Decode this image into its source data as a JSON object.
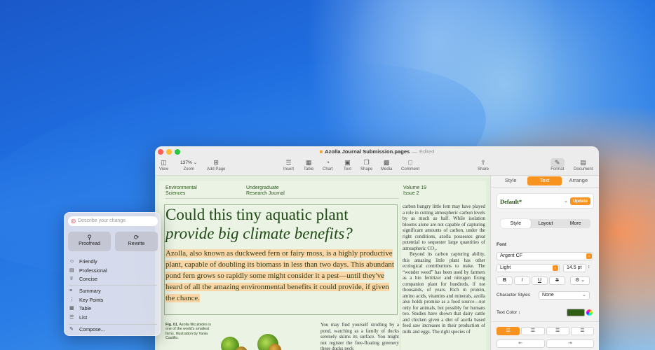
{
  "window": {
    "title": "Azolla Journal Submission.pages",
    "status": "Edited",
    "traffic_lights": {
      "close": "#ff5f57",
      "minimize": "#febc2e",
      "zoom": "#28c840"
    }
  },
  "toolbar": {
    "view": "View",
    "zoom_value": "137%",
    "zoom": "Zoom",
    "add_page": "Add Page",
    "insert": "Insert",
    "table": "Table",
    "chart": "Chart",
    "text": "Text",
    "shape": "Shape",
    "media": "Media",
    "comment": "Comment",
    "share": "Share",
    "format": "Format",
    "document": "Document"
  },
  "page": {
    "header_left": "Environmental Sciences",
    "header_mid": "Undergraduate Research Journal",
    "header_right": "Volume 19 Issue 2",
    "headline_line1": "Could this tiny aquatic plant",
    "headline_line2": "provide big climate benefits?",
    "lead": "Azolla, also known as duckweed fern or fairy moss, is a highly productive plant, capable of doubling its biomass in less than two days. This abundant pond fern grows so rapidly some might consider it a pest—until they've heard of all the amazing environmental benefits it could provide, if given the chance.",
    "fig_label": "Fig. 01.",
    "fig_caption": "Azolla filiculoides is one of the world's smallest ferns. Illustration by Tania Castillo.",
    "body_mid": "You may find yourself strolling by a pond, watching as a family of ducks serenely skims its surface. You might not register the free-floating greenery these ducks peck",
    "body_right_p1": "carbon hungry little fern may have played a role in cutting atmospheric carbon levels by as much as half. While isolation blooms alone are not capable of capturing significant amounts of carbon, under the right conditions, azolla possesses great potential to sequester large quantities of atmospheric CO₂.",
    "body_right_p2": "Beyond its carbon capturing ability, this amazing little plant has other ecological contributions to make. The “wonder weed” has been used by farmers as a bio fertilizer and nitrogen fixing companion plant for hundreds, if not thousands, of years. Rich in protein, amino acids, vitamins and minerals, azolla also holds promise as a food source—not only for animals, but possibly for humans too. Studies have shown that dairy cattle and chicken given a diet of azolla based feed saw increases in their production of milk and eggs. The right species of"
  },
  "inspector": {
    "tabs": [
      "Style",
      "Text",
      "Arrange"
    ],
    "active_tab": "Text",
    "paragraph_style": "Default*",
    "update": "Update",
    "sub_tabs": [
      "Style",
      "Layout",
      "More"
    ],
    "font_label": "Font",
    "font_family": "Argent CF",
    "font_weight": "Light",
    "font_size": "14.5 pt",
    "bold": "B",
    "italic": "I",
    "underline": "U",
    "strike": "S",
    "character_styles_label": "Character Styles",
    "character_styles_value": "None",
    "text_color_label": "Text Color",
    "text_color": "#2e5d13"
  },
  "writing_tools": {
    "placeholder": "Describe your change",
    "proofread": "Proofread",
    "rewrite": "Rewrite",
    "tones": [
      "Friendly",
      "Professional",
      "Concise"
    ],
    "formats": [
      "Summary",
      "Key Points",
      "Table",
      "List"
    ],
    "compose": "Compose..."
  }
}
